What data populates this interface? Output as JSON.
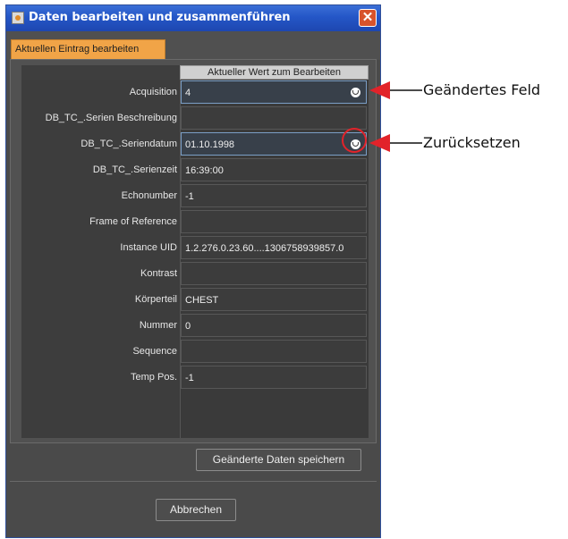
{
  "window": {
    "title": "Daten bearbeiten und zusammenführen",
    "close_icon": "close-icon",
    "title_icon": "java-cup-icon"
  },
  "tab": {
    "label": "Aktuellen Eintrag bearbeiten"
  },
  "table": {
    "value_header": "Aktueller Wert zum Bearbeiten",
    "rows": [
      {
        "label": "Acquisition",
        "value": "4",
        "changed": true
      },
      {
        "label": "DB_TC_.Serien Beschreibung",
        "value": ""
      },
      {
        "label": "DB_TC_.Seriendatum",
        "value": "01.10.1998",
        "changed": true
      },
      {
        "label": "DB_TC_.Serienzeit",
        "value": "16:39:00"
      },
      {
        "label": "Echonumber",
        "value": "-1"
      },
      {
        "label": "Frame of Reference",
        "value": ""
      },
      {
        "label": "Instance UID",
        "value": "1.2.276.0.23.60....1306758939857.0"
      },
      {
        "label": "Kontrast",
        "value": ""
      },
      {
        "label": "Körperteil",
        "value": "CHEST"
      },
      {
        "label": "Nummer",
        "value": "0"
      },
      {
        "label": "Sequence",
        "value": ""
      },
      {
        "label": "Temp Pos.",
        "value": "-1"
      }
    ]
  },
  "buttons": {
    "save": "Geänderte Daten speichern",
    "cancel": "Abbrechen"
  },
  "annotations": {
    "changed_field": "Geändertes Feld",
    "reset": "Zurücksetzen",
    "color": "#e2232a"
  }
}
